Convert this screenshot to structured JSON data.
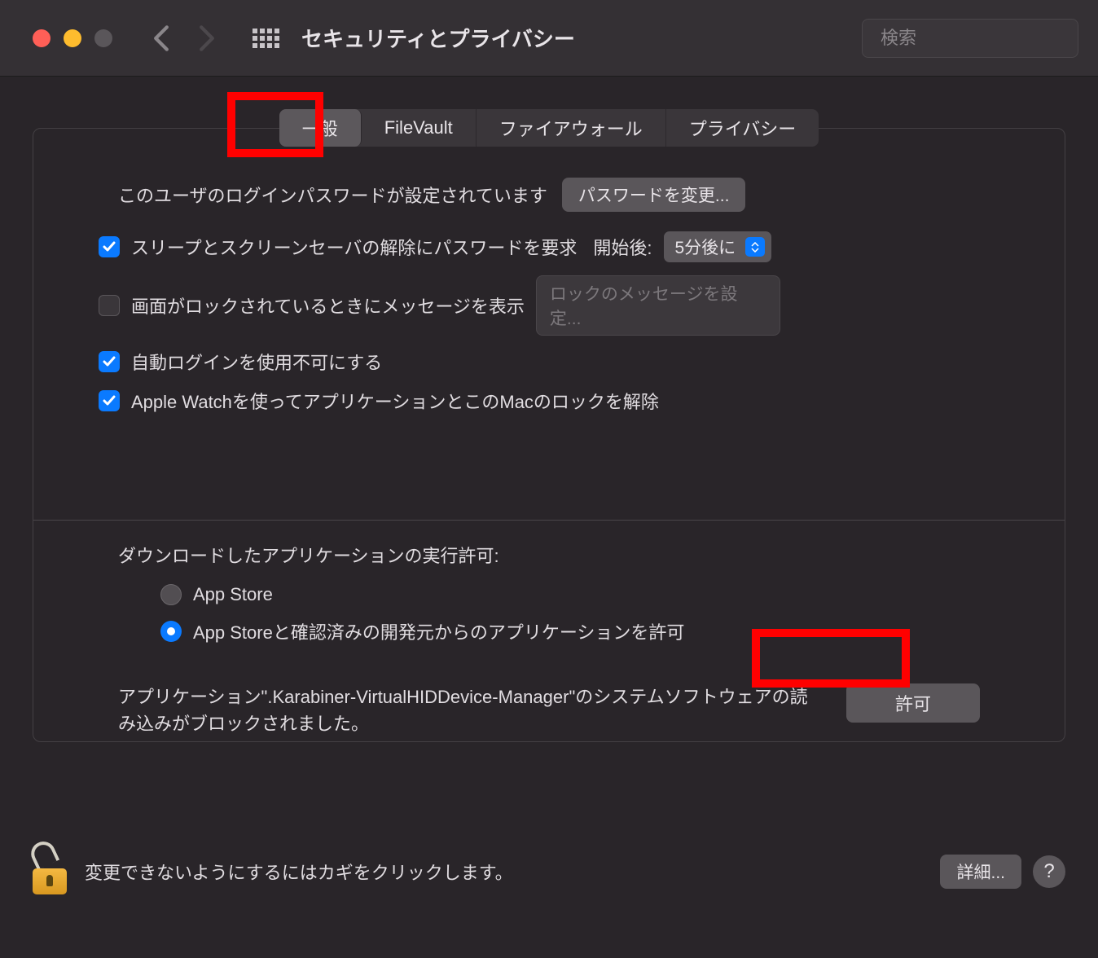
{
  "header": {
    "title": "セキュリティとプライバシー",
    "search_placeholder": "検索"
  },
  "tabs": {
    "general": "一般",
    "filevault": "FileVault",
    "firewall": "ファイアウォール",
    "privacy": "プライバシー"
  },
  "general": {
    "login_password_text": "このユーザのログインパスワードが設定されています",
    "change_password_btn": "パスワードを変更...",
    "require_password_label": "スリープとスクリーンセーバの解除にパスワードを要求",
    "after_label": "開始後:",
    "delay_value": "5分後に",
    "show_message_label": "画面がロックされているときにメッセージを表示",
    "lock_message_placeholder": "ロックのメッセージを設定...",
    "disable_auto_login_label": "自動ログインを使用不可にする",
    "apple_watch_label": "Apple Watchを使ってアプリケーションとこのMacのロックを解除",
    "download_title": "ダウンロードしたアプリケーションの実行許可:",
    "radio_appstore": "App Store",
    "radio_identified": "App Storeと確認済みの開発元からのアプリケーションを許可",
    "blocked_text": "アプリケーション\".Karabiner-VirtualHIDDevice-Manager\"のシステムソフトウェアの読み込みがブロックされました。",
    "allow_btn": "許可"
  },
  "footer": {
    "lock_text": "変更できないようにするにはカギをクリックします。",
    "advanced_btn": "詳細...",
    "help": "?"
  }
}
